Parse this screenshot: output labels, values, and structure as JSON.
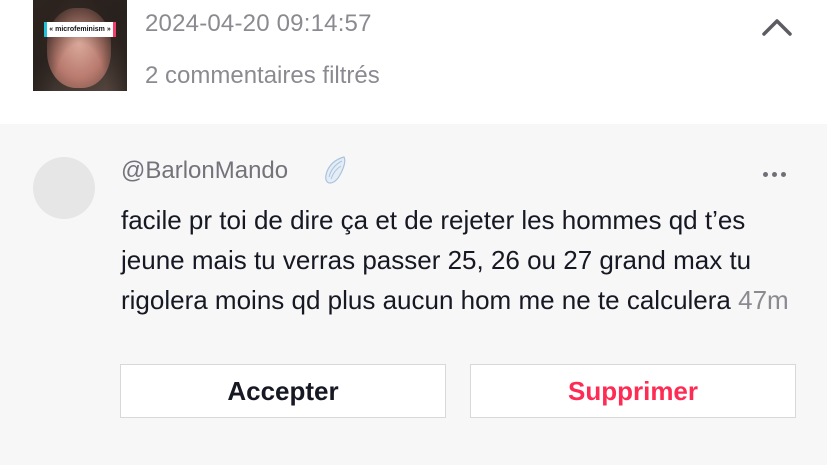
{
  "header": {
    "thumbnail_caption": "« microfeminism »",
    "date": "2024-04-20 09:14:57",
    "filtered_count": "2 commentaires filtrés",
    "collapse_icon": "chevron-up-icon"
  },
  "comment": {
    "username": "@BarlonMando",
    "badge_icon": "angel-wing-icon",
    "text": "facile pr toi de dire ça et de rejeter les hommes qd t’es jeune mais tu verras passer 25, 26 ou 27 grand max tu rigolera moins qd plus aucun hom me ne te calculera",
    "time": "47m",
    "more_icon": "more-options-icon"
  },
  "actions": {
    "accept_label": "Accepter",
    "delete_label": "Supprimer"
  },
  "colors": {
    "delete_text": "#fe2c55",
    "panel_bg": "#f7f7f7",
    "secondary_text": "#8a8b91"
  }
}
